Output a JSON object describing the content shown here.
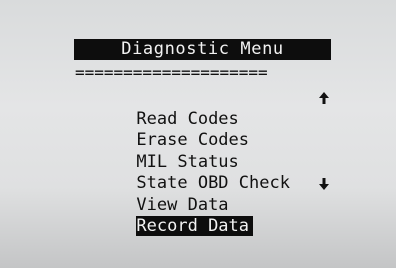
{
  "screen": {
    "title": "Diagnostic Menu",
    "separator": "===================="
  },
  "menu": {
    "items": [
      {
        "label": "Read Codes"
      },
      {
        "label": "Erase Codes"
      },
      {
        "label": "MIL Status"
      },
      {
        "label": "State OBD Check"
      },
      {
        "label": "View Data"
      },
      {
        "label": "Record Data",
        "selected": true
      }
    ],
    "scroll_up_icon": "arrow-up-icon",
    "scroll_down_icon": "arrow-down-icon"
  }
}
